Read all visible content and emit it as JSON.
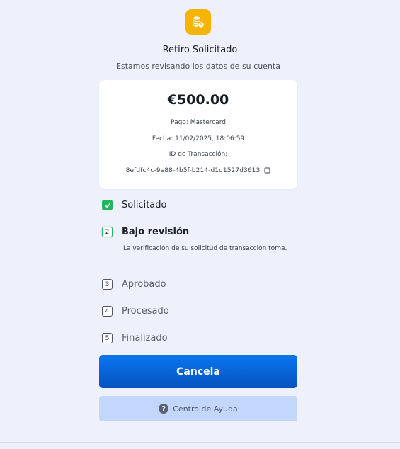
{
  "header": {
    "icon": "coins-clock-icon",
    "title": "Retiro Solicitado",
    "subtitle": "Estamos revisando los datos de su cuenta"
  },
  "transaction": {
    "amount": "€500.00",
    "payment": "Pago: Mastercard",
    "date": "Fecha: 11/02/2025, 18:06:59",
    "id_label": "ID de Transacción:",
    "id_value": "8efdfc4c-9e88-4b5f-b214-d1d1527d3613",
    "copy_icon": "copy-icon"
  },
  "steps": [
    {
      "number": "",
      "label": "Solicitado",
      "state": "done"
    },
    {
      "number": "2",
      "label": "Bajo revisión",
      "state": "active",
      "description": "La verificación de su solicitud de transacción toma."
    },
    {
      "number": "3",
      "label": "Aprobado",
      "state": "pending"
    },
    {
      "number": "4",
      "label": "Procesado",
      "state": "pending"
    },
    {
      "number": "5",
      "label": "Finalizado",
      "state": "pending"
    }
  ],
  "actions": {
    "cancel_label": "Cancela",
    "help_label": "Centro de Ayuda",
    "help_icon": "question-circle-icon"
  },
  "colors": {
    "background": "#eef1fb",
    "accent_yellow": "#f5b400",
    "success_green": "#1fb95b",
    "primary_blue": "#0a6ae6",
    "help_button": "#c3d6fb"
  }
}
